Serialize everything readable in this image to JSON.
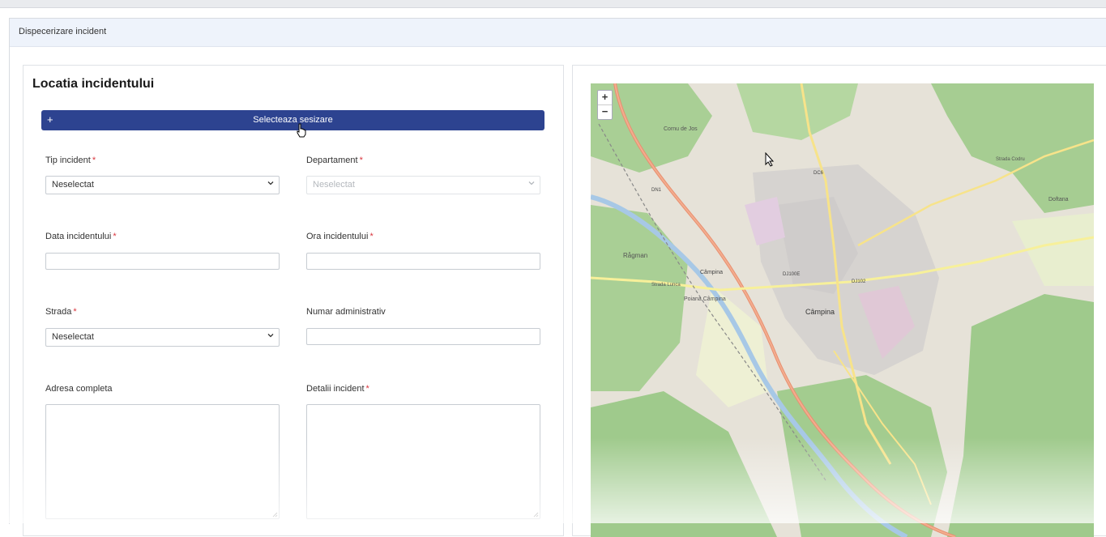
{
  "breadcrumb": "Dispecerizare incident",
  "form": {
    "title": "Locatia incidentului",
    "select_button": {
      "icon": "+",
      "label": "Selecteaza sesizare"
    },
    "required_mark": "*",
    "tip_incident": {
      "label": "Tip incident",
      "value": "Neselectat"
    },
    "departament": {
      "label": "Departament",
      "value": "Neselectat"
    },
    "data_incidentului": {
      "label": "Data incidentului",
      "value": ""
    },
    "ora_incidentului": {
      "label": "Ora incidentului",
      "value": ""
    },
    "strada": {
      "label": "Strada",
      "value": "Neselectat"
    },
    "numar_administrativ": {
      "label": "Numar administrativ",
      "value": ""
    },
    "adresa_completa": {
      "label": "Adresa completa",
      "value": ""
    },
    "detalii_incident": {
      "label": "Detalii incident",
      "value": ""
    }
  },
  "map": {
    "zoom_in": "+",
    "zoom_out": "−",
    "labels": {
      "main_town": "Câmpina",
      "west_town": "Câmpina",
      "ragman": "Rågman",
      "poiana": "Poiana Câmpina",
      "corn": "Cornu de Jos",
      "doftana": "Doftana",
      "codru": "Strada Codru",
      "lunca": "Strada Lunca",
      "dj": "DJ100E",
      "dj2": "DJ102",
      "dc6": "DC6",
      "dn1": "DN1"
    }
  },
  "colors": {
    "primary": "#2d4390",
    "required": "#d9363e",
    "breadcrumb_bg": "#eef3fb"
  }
}
